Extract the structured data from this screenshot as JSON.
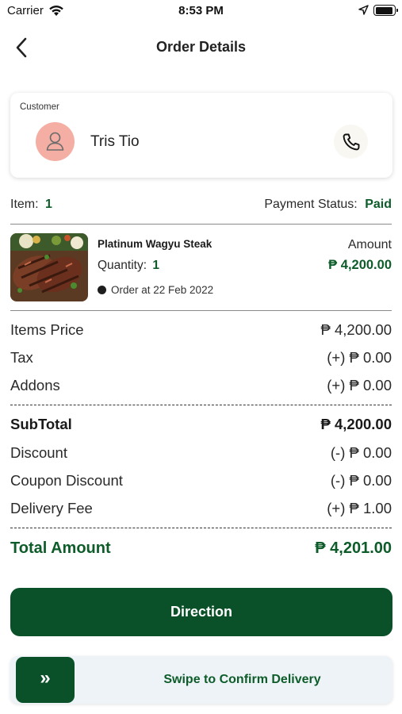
{
  "status_bar": {
    "carrier": "Carrier",
    "time": "8:53 PM"
  },
  "nav": {
    "back_icon": "chevron-left-icon",
    "title": "Order Details"
  },
  "customer": {
    "label": "Customer",
    "name": "Tris Tio",
    "avatar_icon": "user-icon",
    "phone_icon": "phone-icon"
  },
  "order": {
    "item_label": "Item:",
    "item_count": "1",
    "payment_label": "Payment Status:",
    "payment_status": "Paid"
  },
  "product": {
    "name": "Platinum Wagyu Steak",
    "quantity_label": "Quantity:",
    "quantity": "1",
    "order_date": "Order at 22 Feb 2022",
    "amount_label": "Amount",
    "amount": "₱ 4,200.00"
  },
  "summary": {
    "items_price": {
      "label": "Items Price",
      "value": "₱ 4,200.00"
    },
    "tax": {
      "label": "Tax",
      "value": "(+) ₱ 0.00"
    },
    "addons": {
      "label": "Addons",
      "value": "(+) ₱ 0.00"
    },
    "subtotal": {
      "label": "SubTotal",
      "value": "₱ 4,200.00"
    },
    "discount": {
      "label": "Discount",
      "value": "(-) ₱ 0.00"
    },
    "coupon_discount": {
      "label": "Coupon Discount",
      "value": "(-) ₱ 0.00"
    },
    "delivery_fee": {
      "label": "Delivery Fee",
      "value": "(+) ₱ 1.00"
    },
    "total": {
      "label": "Total Amount",
      "value": "₱ 4,201.00"
    }
  },
  "actions": {
    "direction_label": "Direction",
    "swipe_label": "Swipe to Confirm Delivery",
    "swipe_icon": "»"
  },
  "colors": {
    "brand_green": "#0a5129",
    "accent_green": "#0d5c2a",
    "avatar_bg": "#f4aea3"
  }
}
